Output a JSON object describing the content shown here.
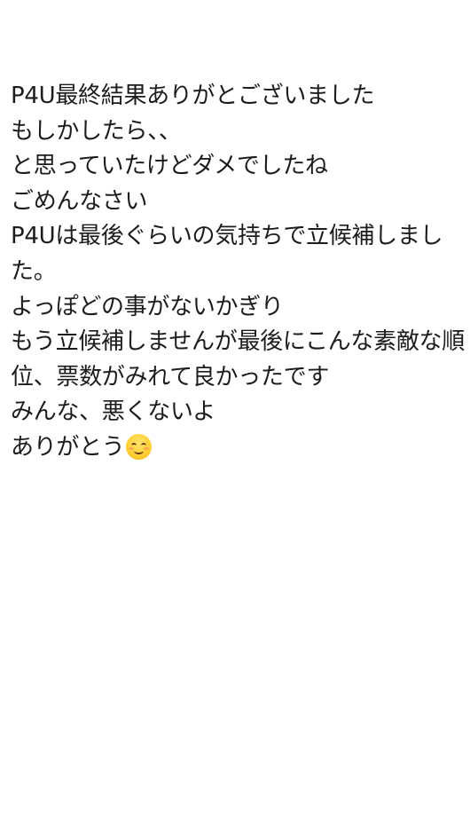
{
  "note": {
    "lines": [
      "P4U最終結果ありがとございました",
      "もしかしたら、、",
      "と思っていたけどダメでしたね",
      "ごめんなさい",
      "P4Uは最後ぐらいの気持ちで立候補しまし",
      "た。",
      "よっぽどの事がないかぎり",
      "もう立候補しませんが最後にこんな素敵な順",
      "位、票数がみれて良かったです",
      "みんな、悪くないよ",
      "ありがとう"
    ],
    "emoji": "smiling-face-with-smiling-eyes"
  }
}
